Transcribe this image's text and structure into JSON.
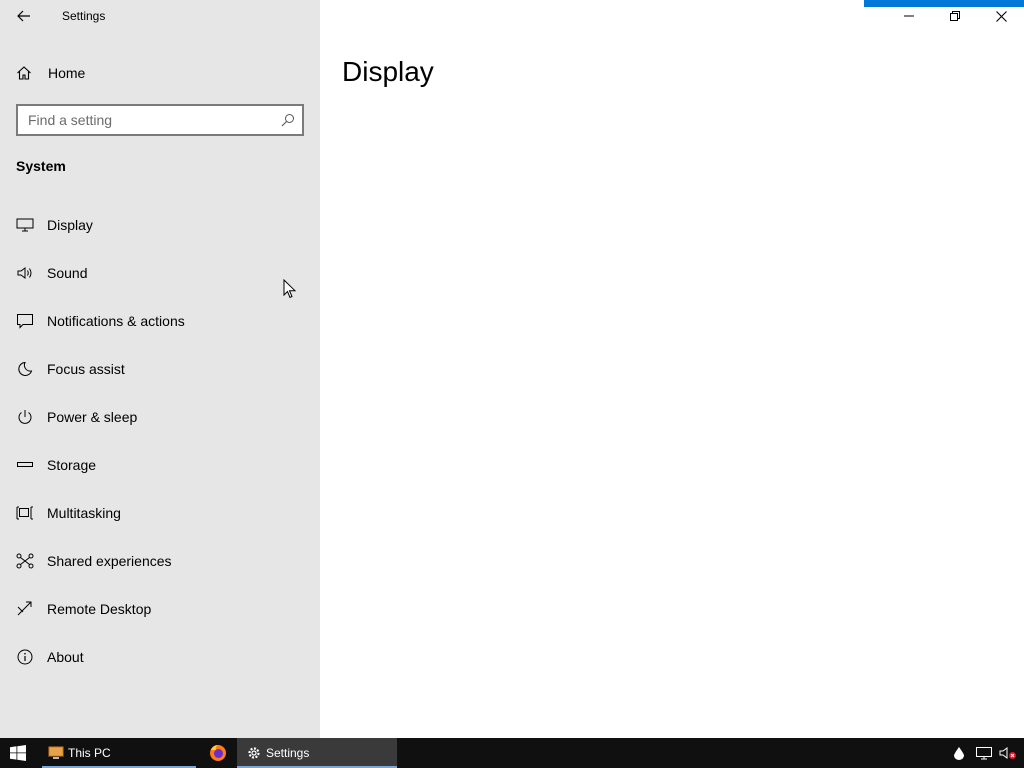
{
  "window": {
    "title": "Settings",
    "controls": {
      "minimize": "minimize",
      "restore": "restore",
      "close": "close"
    }
  },
  "sidebar": {
    "home_label": "Home",
    "search": {
      "placeholder": "Find a setting",
      "value": ""
    },
    "section": "System",
    "items": [
      {
        "label": "Display",
        "icon": "monitor-icon"
      },
      {
        "label": "Sound",
        "icon": "speaker-icon"
      },
      {
        "label": "Notifications & actions",
        "icon": "message-icon"
      },
      {
        "label": "Focus assist",
        "icon": "moon-icon"
      },
      {
        "label": "Power & sleep",
        "icon": "power-icon"
      },
      {
        "label": "Storage",
        "icon": "storage-icon"
      },
      {
        "label": "Multitasking",
        "icon": "multitasking-icon"
      },
      {
        "label": "Shared experiences",
        "icon": "share-icon"
      },
      {
        "label": "Remote Desktop",
        "icon": "remote-desktop-icon"
      },
      {
        "label": "About",
        "icon": "info-icon"
      }
    ]
  },
  "main": {
    "page_title": "Display"
  },
  "taskbar": {
    "apps": [
      {
        "label": "This PC",
        "icon": "folder-icon"
      },
      {
        "label": "",
        "icon": "firefox-icon"
      },
      {
        "label": "Settings",
        "icon": "gear-icon"
      }
    ],
    "tray": [
      "dropbox-icon",
      "network-icon",
      "volume-muted-icon"
    ]
  },
  "colors": {
    "sidebar_bg": "#e6e6e6",
    "accent": "#0078d7",
    "taskbar_bg": "#101010"
  }
}
